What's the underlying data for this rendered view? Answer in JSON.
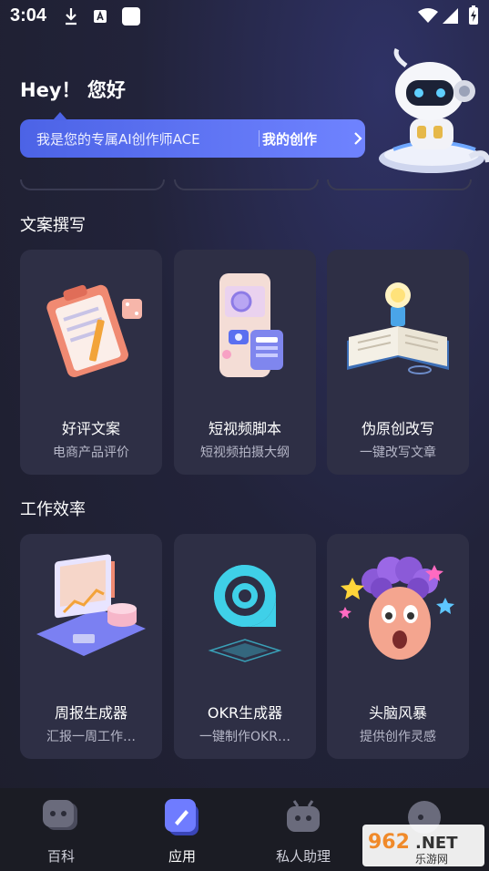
{
  "status_bar": {
    "time": "3:04"
  },
  "header": {
    "greeting": "Hey！ 您好",
    "intro": "我是您的专属AI创作师ACE",
    "my_creations": "我的创作"
  },
  "sections": [
    {
      "title": "文案撰写",
      "cards": [
        {
          "title": "好评文案",
          "subtitle": "电商产品评价"
        },
        {
          "title": "短视频脚本",
          "subtitle": "短视频拍摄大纲"
        },
        {
          "title": "伪原创改写",
          "subtitle": "一键改写文章"
        }
      ]
    },
    {
      "title": "工作效率",
      "cards": [
        {
          "title": "周报生成器",
          "subtitle": "汇报一周工作…"
        },
        {
          "title": "OKR生成器",
          "subtitle": "一键制作OKR…"
        },
        {
          "title": "头脑风暴",
          "subtitle": "提供创作灵感"
        }
      ]
    }
  ],
  "bottom_nav": [
    {
      "label": "百科",
      "icon": "chat-bubble-icon"
    },
    {
      "label": "应用",
      "icon": "pen-icon",
      "active": true
    },
    {
      "label": "私人助理",
      "icon": "robot-icon"
    },
    {
      "label": "",
      "icon": "user-icon"
    }
  ],
  "watermark": {
    "brand": "962.NET",
    "caption": "乐游网"
  },
  "colors": {
    "background": "#1f2030",
    "card": "#2e2f45",
    "accent": "#5a6ff0",
    "nav": "#1b1c24"
  }
}
